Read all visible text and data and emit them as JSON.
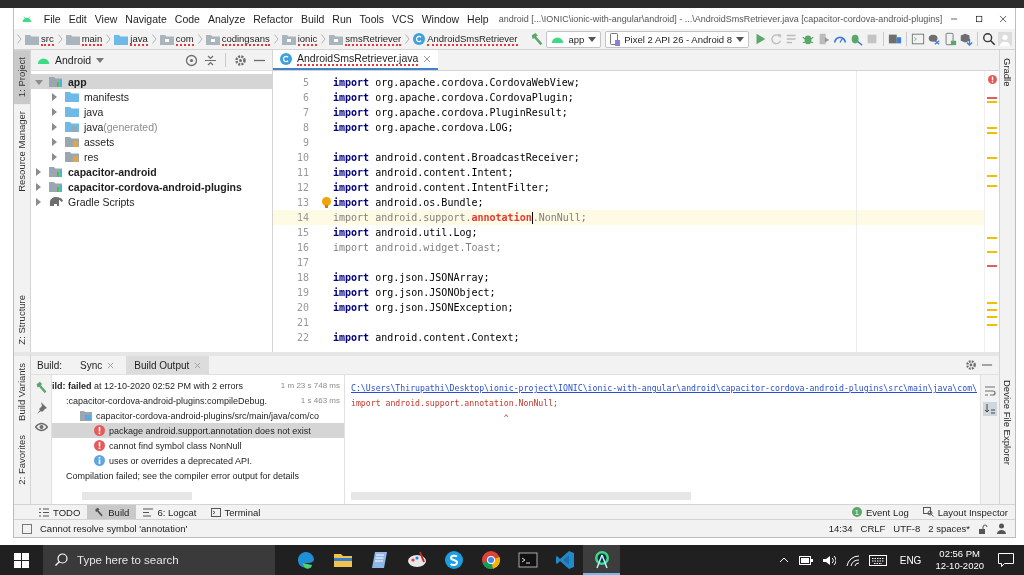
{
  "window": {
    "title": "android [...\\IONIC\\ionic-with-angular\\android] - ...\\AndroidSmsRetriever.java [capacitor-cordova-android-plugins]",
    "menu": [
      "File",
      "Edit",
      "View",
      "Navigate",
      "Code",
      "Analyze",
      "Refactor",
      "Build",
      "Run",
      "Tools",
      "VCS",
      "Window",
      "Help"
    ]
  },
  "breadcrumbs": [
    {
      "label": "src",
      "kind": "folder",
      "error": true
    },
    {
      "label": "main",
      "kind": "folder",
      "error": true
    },
    {
      "label": "java",
      "kind": "source-folder",
      "error": true
    },
    {
      "label": "com",
      "kind": "package",
      "error": true
    },
    {
      "label": "codingsans",
      "kind": "package",
      "error": true
    },
    {
      "label": "ionic",
      "kind": "package",
      "error": true
    },
    {
      "label": "smsRetriever",
      "kind": "package",
      "error": true
    },
    {
      "label": "AndroidSmsRetriever",
      "kind": "class",
      "error": true
    }
  ],
  "toolbar": {
    "run_config": "app",
    "device": "Pixel 2 API 26 - Android 8"
  },
  "left_stripe": {
    "main": [
      {
        "label": "1: Project",
        "selected": true
      },
      {
        "label": "Resource Manager",
        "selected": false
      },
      {
        "label": "Z: Structure",
        "selected": false
      }
    ],
    "build": [
      {
        "label": "Build Variants",
        "selected": false
      },
      {
        "label": "2: Favorites",
        "selected": false
      }
    ]
  },
  "right_stripe": {
    "main": [
      "Gradle"
    ],
    "build": [
      "Device File Explorer"
    ]
  },
  "project": {
    "view": "Android",
    "tree": [
      {
        "label": "app",
        "kind": "module",
        "expanded": true,
        "selected": true,
        "children": [
          {
            "label": "manifests",
            "kind": "folder",
            "expanded": false,
            "selected": false
          },
          {
            "label": "java",
            "kind": "folder",
            "expanded": false,
            "selected": false
          },
          {
            "label": "java",
            "note": "(generated)",
            "kind": "generated-folder",
            "expanded": false,
            "selected": false
          },
          {
            "label": "assets",
            "kind": "resource-folder",
            "expanded": false,
            "selected": false
          },
          {
            "label": "res",
            "kind": "resource-folder",
            "expanded": false,
            "selected": false
          }
        ]
      },
      {
        "label": "capacitor-android",
        "kind": "module",
        "expanded": false,
        "selected": false
      },
      {
        "label": "capacitor-cordova-android-plugins",
        "kind": "module",
        "expanded": false,
        "selected": false
      },
      {
        "label": "Gradle Scripts",
        "kind": "gradle",
        "expanded": false,
        "selected": false
      }
    ]
  },
  "editor": {
    "tab": {
      "label": "AndroidSmsRetriever.java",
      "error": true
    },
    "lines": [
      {
        "number": "5",
        "segments": [
          {
            "text": "import",
            "kind": "keyword"
          },
          {
            "text": " org.apache.cordova.CordovaWebView;",
            "kind": "plain"
          }
        ]
      },
      {
        "number": "6",
        "segments": [
          {
            "text": "import",
            "kind": "keyword"
          },
          {
            "text": " org.apache.cordova.CordovaPlugin;",
            "kind": "plain"
          }
        ]
      },
      {
        "number": "7",
        "segments": [
          {
            "text": "import",
            "kind": "keyword"
          },
          {
            "text": " org.apache.cordova.PluginResult;",
            "kind": "plain"
          }
        ]
      },
      {
        "number": "8",
        "segments": [
          {
            "text": "import",
            "kind": "keyword"
          },
          {
            "text": " org.apache.cordova.LOG;",
            "kind": "plain"
          }
        ]
      },
      {
        "number": "9"
      },
      {
        "number": "10",
        "segments": [
          {
            "text": "import",
            "kind": "keyword"
          },
          {
            "text": " android.content.BroadcastReceiver;",
            "kind": "plain"
          }
        ]
      },
      {
        "number": "11",
        "segments": [
          {
            "text": "import",
            "kind": "keyword"
          },
          {
            "text": " android.content.Intent;",
            "kind": "plain"
          }
        ]
      },
      {
        "number": "12",
        "segments": [
          {
            "text": "import",
            "kind": "keyword"
          },
          {
            "text": " android.content.IntentFilter;",
            "kind": "plain"
          }
        ]
      },
      {
        "number": "13",
        "bulb": true,
        "segments": [
          {
            "text": "import",
            "kind": "keyword"
          },
          {
            "text": " android.os.Bundle;",
            "kind": "plain"
          }
        ]
      },
      {
        "number": "14",
        "current": true,
        "segments": [
          {
            "text": "import android.support.",
            "kind": "unused"
          },
          {
            "text": "annotation",
            "kind": "error",
            "cursor": true
          },
          {
            "text": ".NonNull;",
            "kind": "unused"
          }
        ]
      },
      {
        "number": "15",
        "segments": [
          {
            "text": "import",
            "kind": "keyword"
          },
          {
            "text": " android.util.Log;",
            "kind": "plain"
          }
        ]
      },
      {
        "number": "16",
        "segments": [
          {
            "text": "import android.widget.Toast;",
            "kind": "unused"
          }
        ]
      },
      {
        "number": "17"
      },
      {
        "number": "18",
        "segments": [
          {
            "text": "import",
            "kind": "keyword"
          },
          {
            "text": " org.json.JSONArray;",
            "kind": "plain"
          }
        ]
      },
      {
        "number": "19",
        "segments": [
          {
            "text": "import",
            "kind": "keyword"
          },
          {
            "text": " org.json.JSONObject;",
            "kind": "plain"
          }
        ]
      },
      {
        "number": "20",
        "segments": [
          {
            "text": "import",
            "kind": "keyword"
          },
          {
            "text": " org.json.JSONException;",
            "kind": "plain"
          }
        ]
      },
      {
        "number": "21"
      },
      {
        "number": "22",
        "segments": [
          {
            "text": "import",
            "kind": "keyword"
          },
          {
            "text": " android.content.Context;",
            "kind": "plain"
          }
        ]
      }
    ]
  },
  "build": {
    "label": "Build:",
    "tabs": [
      {
        "label": "Sync",
        "selected": false
      },
      {
        "label": "Build Output",
        "selected": true
      }
    ],
    "tree": [
      {
        "text": "**ild: failed** at 12-10-2020 02:52 PM with 2 errors",
        "time": "1 m 23 s 748 ms",
        "selected": false,
        "children": [
          {
            "text": ":capacitor-cordova-android-plugins:compileDebug.",
            "time": "1 s 463 ms",
            "selected": false,
            "children": [
              {
                "kind": "file",
                "text": "capacitor-cordova-android-plugins/src/main/java/com/co",
                "selected": false,
                "children": [
                  {
                    "kind": "error",
                    "text": "package android.support.annotation does not exist",
                    "selected": true
                  },
                  {
                    "kind": "error",
                    "text": "cannot find symbol class NonNull",
                    "selected": false
                  },
                  {
                    "kind": "info",
                    "text": "uses or overrides a deprecated API.",
                    "selected": false
                  }
                ]
              }
            ]
          },
          {
            "text": "Compilation failed; see the compiler error output for details",
            "selected": false
          }
        ]
      }
    ],
    "console": {
      "link": "C:\\Users\\Thirupathi\\Desktop\\ionic-project\\IONIC\\ionic-with-angular\\android\\capacitor-cordova-android-plugins\\src\\main\\java\\com\\",
      "lines": [
        "import android.support.annotation.NonNull;",
        "^"
      ]
    }
  },
  "tool_tabs": [
    {
      "label": "TODO",
      "kind": "todo",
      "selected": false
    },
    {
      "label": "Build",
      "kind": "build",
      "selected": true
    },
    {
      "label": "6: Logcat",
      "kind": "logcat",
      "selected": false
    },
    {
      "label": "Terminal",
      "kind": "terminal",
      "selected": false
    }
  ],
  "tool_tabs_right": [
    {
      "label": "Event Log",
      "kind": "event-log",
      "badge": "1"
    },
    {
      "label": "Layout Inspector",
      "kind": "inspector"
    }
  ],
  "status_bar": {
    "message": "Cannot resolve symbol 'annotation'",
    "position": "14:34",
    "line_separator": "CRLF",
    "encoding": "UTF-8",
    "indent": "2 spaces*"
  },
  "taskbar": {
    "search_placeholder": "Type here to search",
    "apps": [
      {
        "kind": "edge",
        "active": false
      },
      {
        "kind": "explorer",
        "active": false
      },
      {
        "kind": "notepad",
        "active": false
      },
      {
        "kind": "paint",
        "active": false
      },
      {
        "kind": "skype",
        "active": false
      },
      {
        "kind": "chrome",
        "active": false
      },
      {
        "kind": "terminal",
        "active": false
      },
      {
        "kind": "vscode",
        "active": false
      },
      {
        "kind": "studio",
        "active": true
      }
    ],
    "language": "ENG",
    "time": "02:56 PM",
    "date": "12-10-2020"
  }
}
